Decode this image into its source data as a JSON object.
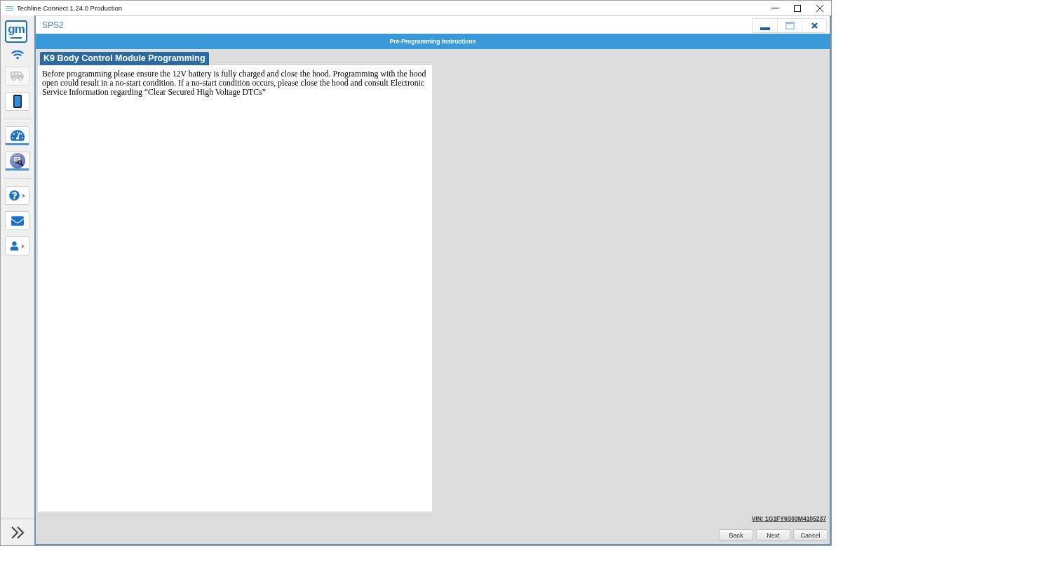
{
  "window": {
    "title": "Techline Connect 1.24.0 Production"
  },
  "sidebar": {
    "logo": {
      "text": "gm"
    },
    "groups": [
      {
        "items": [
          {
            "kind": "wifi",
            "disabled": false,
            "active": false,
            "submenu": false
          },
          {
            "kind": "vehicle",
            "disabled": true,
            "active": false,
            "submenu": false
          },
          {
            "kind": "device",
            "disabled": false,
            "active": false,
            "submenu": false
          }
        ]
      },
      {
        "items": [
          {
            "kind": "gauge",
            "disabled": false,
            "active": true,
            "submenu": false
          },
          {
            "kind": "screen",
            "disabled": false,
            "active": true,
            "submenu": false
          }
        ]
      },
      {
        "items": [
          {
            "kind": "help",
            "disabled": false,
            "active": false,
            "submenu": true
          },
          {
            "kind": "mail",
            "disabled": false,
            "active": false,
            "submenu": false
          },
          {
            "kind": "user",
            "disabled": false,
            "active": false,
            "submenu": true
          }
        ]
      }
    ]
  },
  "app": {
    "title": "SPS2"
  },
  "banner": {
    "title": "Pre-Programming Instructions"
  },
  "module": {
    "title": "K9 Body Control Module Programming",
    "instructions": "Before programming please ensure the 12V battery is fully charged and close the hood. Programming with the hood open could result in a no-start condition. If a no-start condition occurs, please close the hood and consult Electronic Service Information regarding “Clear Secured High Voltage DTCs”"
  },
  "footer": {
    "vin": "VIN: 1G1FY6S03M4105237",
    "buttons": [
      "Back",
      "Next",
      "Cancel"
    ]
  }
}
